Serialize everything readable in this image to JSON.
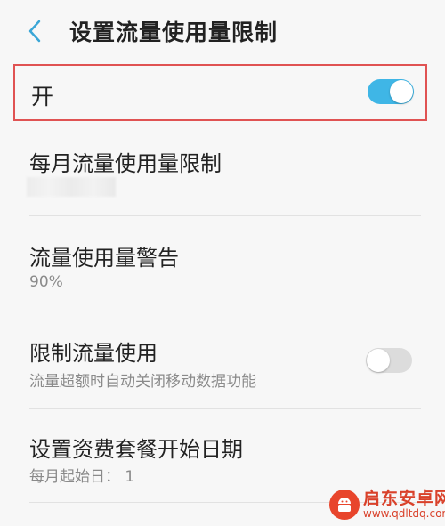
{
  "header": {
    "back_icon": "chevron-left-icon",
    "title": "设置流量使用量限制"
  },
  "master_switch": {
    "label": "开",
    "state": "on",
    "color": "#3fb6e6"
  },
  "items": [
    {
      "title": "每月流量使用量限制",
      "subtitle": ""
    },
    {
      "title": "流量使用量警告",
      "subtitle": "90%"
    },
    {
      "title": "限制流量使用",
      "subtitle": "流量超额时自动关闭移动数据功能",
      "toggle_state": "off"
    },
    {
      "title": "设置资费套餐开始日期",
      "subtitle": "每月起始日： 1"
    }
  ],
  "watermark": {
    "name": "启东安卓网",
    "url": "www.qdltdq.com",
    "color": "#d9412a"
  }
}
